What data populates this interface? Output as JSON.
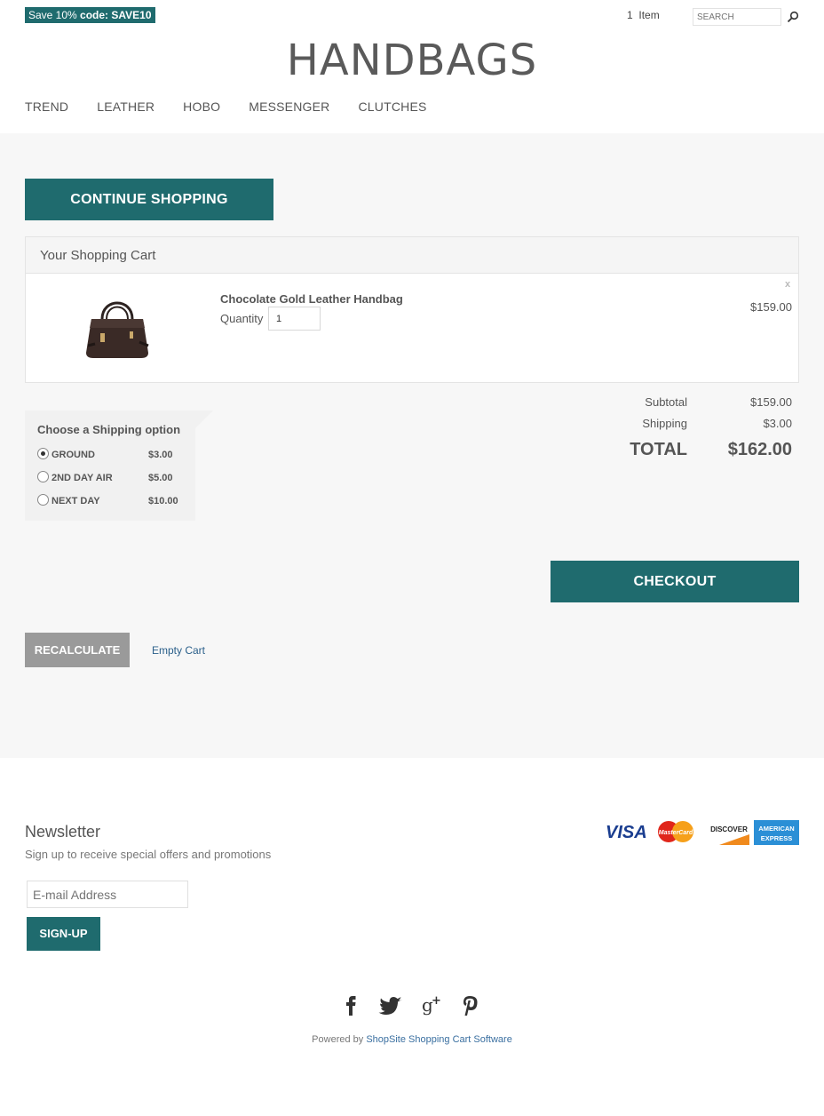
{
  "promo": {
    "label": "Save 10%  ",
    "code_prefix": "code: ",
    "code": "SAVE10"
  },
  "header": {
    "cart_count": "1",
    "cart_label": "Item",
    "search_placeholder": "SEARCH",
    "brand": "HANDBAGS"
  },
  "nav": [
    "TREND",
    "LEATHER",
    "HOBO",
    "MESSENGER",
    "CLUTCHES"
  ],
  "continue_label": "CONTINUE SHOPPING",
  "cart": {
    "title": "Your Shopping Cart",
    "item": {
      "name": "Chocolate Gold Leather Handbag",
      "quantity_label": "Quantity",
      "quantity": "1",
      "remove": "x",
      "price": "$159.00"
    }
  },
  "totals": {
    "subtotal_label": "Subtotal",
    "subtotal": "$159.00",
    "shipping_label": "Shipping",
    "shipping": "$3.00",
    "total_label": "TOTAL",
    "total": "$162.00"
  },
  "shipping": {
    "title": "Choose a Shipping option",
    "options": [
      {
        "name": "GROUND",
        "price": "$3.00",
        "selected": true
      },
      {
        "name": "2ND DAY AIR",
        "price": "$5.00",
        "selected": false
      },
      {
        "name": "NEXT DAY",
        "price": "$10.00",
        "selected": false
      }
    ]
  },
  "checkout_label": "CHECKOUT",
  "recalculate_label": "RECALCULATE",
  "empty_cart_label": "Empty Cart",
  "newsletter": {
    "title": "Newsletter",
    "subtitle": "Sign up to receive special offers and promotions",
    "email_placeholder": "E-mail Address",
    "signup_label": "SIGN-UP"
  },
  "payment_cards": [
    "VISA",
    "MasterCard",
    "DISCOVER",
    "AMERICAN EXPRESS"
  ],
  "social_icons": [
    "facebook-icon",
    "twitter-icon",
    "google-plus-icon",
    "pinterest-icon"
  ],
  "footer": {
    "powered_prefix": "Powered by ",
    "powered_link": "ShopSite Shopping Cart Software"
  },
  "colors": {
    "accent": "#1f6b6e",
    "link": "#2a5f8a",
    "recalc": "#9a9a9a"
  }
}
